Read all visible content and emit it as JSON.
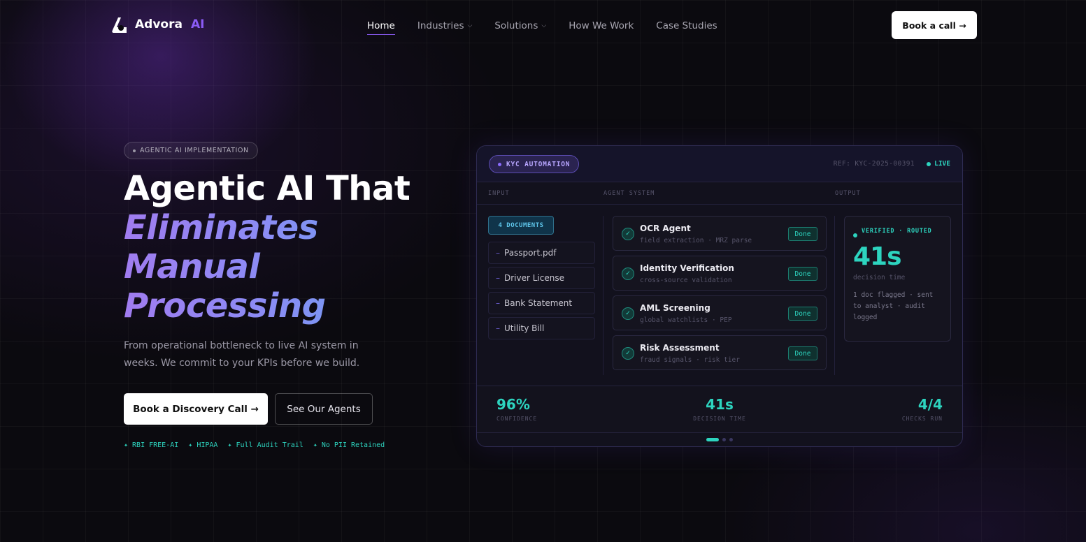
{
  "brand": {
    "name": "Advora",
    "suffix": "AI",
    "icon": "advora-logo-icon",
    "accent": "#8b5cf6"
  },
  "nav": {
    "items": [
      {
        "label": "Home",
        "active": true
      },
      {
        "label": "Industries",
        "dropdown": true
      },
      {
        "label": "Solutions",
        "dropdown": true
      },
      {
        "label": "How We Work"
      },
      {
        "label": "Case Studies"
      }
    ],
    "cta": "Book a call →"
  },
  "hero": {
    "badge": "AGENTIC AI IMPLEMENTATION",
    "title_line1": "Agentic AI That",
    "title_line2": "Eliminates",
    "title_line3": "Manual",
    "title_line4": "Processing",
    "subtitle": "From operational bottleneck to live AI system in weeks. We commit to your KPIs before we build.",
    "primary_button": "Book a Discovery Call →",
    "secondary_button": "See Our Agents",
    "trust": [
      "✦ RBI FREE-AI",
      "✦ HIPAA",
      "✦ Full Audit Trail",
      "✦ No PII Retained"
    ]
  },
  "panel": {
    "tag": "KYC AUTOMATION",
    "ref": "REF: KYC-2025-00391",
    "live": "LIVE",
    "columns": {
      "input": "INPUT",
      "agents": "AGENT SYSTEM",
      "output": "OUTPUT"
    },
    "docs_tag": "4 DOCUMENTS",
    "documents": [
      "Passport.pdf",
      "Driver License",
      "Bank Statement",
      "Utility Bill"
    ],
    "agents": [
      {
        "name": "OCR Agent",
        "desc": "field extraction · MRZ parse",
        "status": "Done"
      },
      {
        "name": "Identity Verification",
        "desc": "cross-source validation",
        "status": "Done"
      },
      {
        "name": "AML Screening",
        "desc": "global watchlists · PEP",
        "status": "Done"
      },
      {
        "name": "Risk Assessment",
        "desc": "fraud signals · risk tier",
        "status": "Done"
      }
    ],
    "output": {
      "status": "VERIFIED · ROUTED",
      "value": "41s",
      "label": "decision time",
      "note": "1 doc flagged · sent to analyst · audit logged"
    },
    "stats": [
      {
        "value": "96%",
        "label": "CONFIDENCE"
      },
      {
        "value": "41s",
        "label": "DECISION TIME"
      },
      {
        "value": "4/4",
        "label": "CHECKS RUN"
      }
    ],
    "accent": "#2dd4bf"
  }
}
